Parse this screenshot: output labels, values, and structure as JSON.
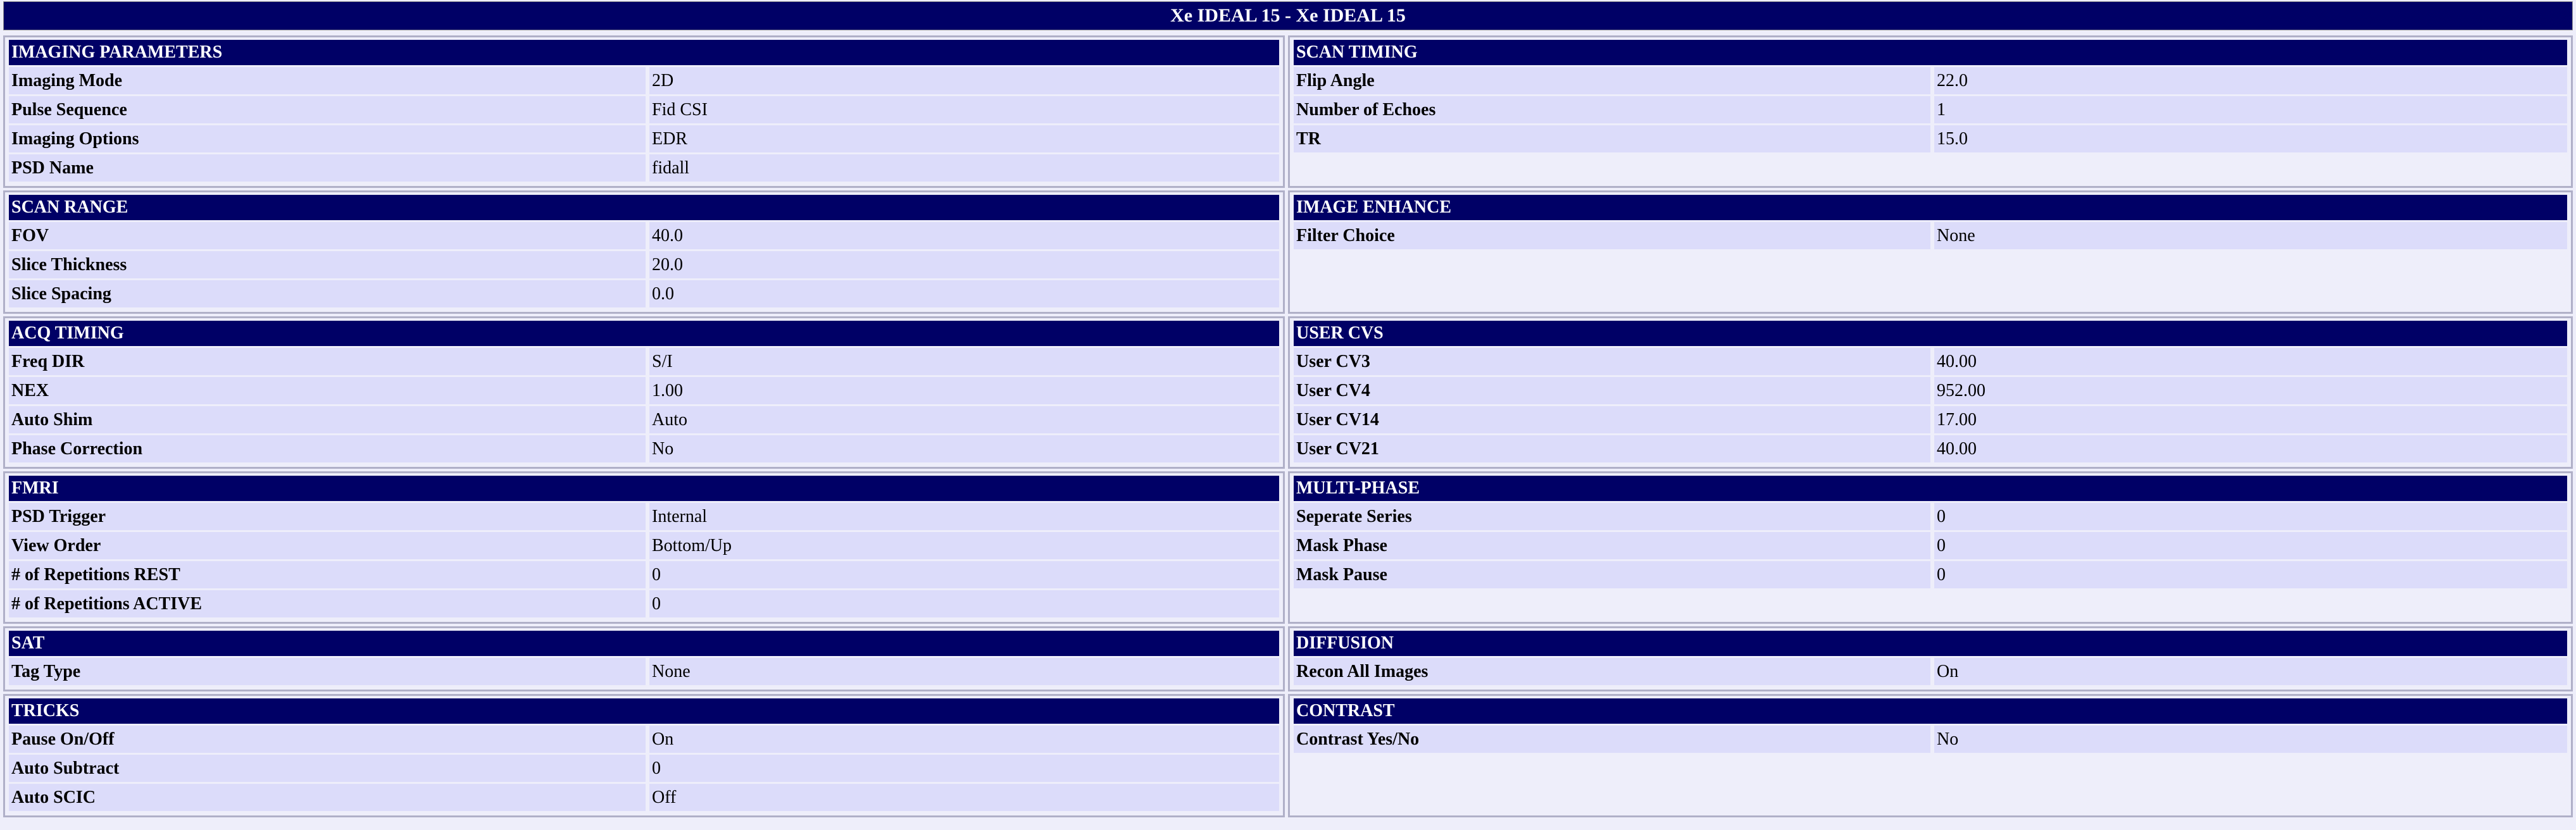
{
  "title": "Xe IDEAL 15 - Xe IDEAL 15",
  "rows": [
    {
      "rows_per_cell": 4,
      "left": {
        "header": "IMAGING PARAMETERS",
        "items": [
          {
            "label": "Imaging Mode",
            "value": "2D"
          },
          {
            "label": "Pulse Sequence",
            "value": "Fid CSI"
          },
          {
            "label": "Imaging Options",
            "value": "EDR"
          },
          {
            "label": "PSD Name",
            "value": "fidall"
          }
        ]
      },
      "right": {
        "header": "SCAN TIMING",
        "items": [
          {
            "label": "Flip Angle",
            "value": "22.0"
          },
          {
            "label": "Number of Echoes",
            "value": "1"
          },
          {
            "label": "TR",
            "value": "15.0"
          }
        ]
      }
    },
    {
      "rows_per_cell": 3,
      "left": {
        "header": "SCAN RANGE",
        "items": [
          {
            "label": "FOV",
            "value": "40.0"
          },
          {
            "label": "Slice Thickness",
            "value": "20.0"
          },
          {
            "label": "Slice Spacing",
            "value": "0.0"
          }
        ]
      },
      "right": {
        "header": "IMAGE ENHANCE",
        "items": [
          {
            "label": "Filter Choice",
            "value": "None"
          }
        ]
      }
    },
    {
      "rows_per_cell": 4,
      "left": {
        "header": "ACQ TIMING",
        "items": [
          {
            "label": "Freq DIR",
            "value": "S/I"
          },
          {
            "label": "NEX",
            "value": "1.00"
          },
          {
            "label": "Auto Shim",
            "value": "Auto"
          },
          {
            "label": "Phase Correction",
            "value": "No"
          }
        ]
      },
      "right": {
        "header": "USER CVS",
        "items": [
          {
            "label": "User CV3",
            "value": "40.00"
          },
          {
            "label": "User CV4",
            "value": "952.00"
          },
          {
            "label": "User CV14",
            "value": "17.00"
          },
          {
            "label": "User CV21",
            "value": "40.00"
          }
        ]
      }
    },
    {
      "rows_per_cell": 4,
      "left": {
        "header": "FMRI",
        "items": [
          {
            "label": "PSD Trigger",
            "value": "Internal"
          },
          {
            "label": "View Order",
            "value": "Bottom/Up"
          },
          {
            "label": "# of Repetitions REST",
            "value": "0"
          },
          {
            "label": "# of Repetitions ACTIVE",
            "value": "0"
          }
        ]
      },
      "right": {
        "header": "MULTI-PHASE",
        "items": [
          {
            "label": "Seperate Series",
            "value": "0"
          },
          {
            "label": "Mask Phase",
            "value": "0"
          },
          {
            "label": "Mask Pause",
            "value": "0"
          }
        ]
      }
    },
    {
      "rows_per_cell": 1,
      "left": {
        "header": "SAT",
        "items": [
          {
            "label": "Tag Type",
            "value": "None"
          }
        ]
      },
      "right": {
        "header": "DIFFUSION",
        "items": [
          {
            "label": "Recon All Images",
            "value": "On"
          }
        ]
      }
    },
    {
      "rows_per_cell": 3,
      "left": {
        "header": "TRICKS",
        "items": [
          {
            "label": "Pause On/Off",
            "value": "On"
          },
          {
            "label": "Auto Subtract",
            "value": "0"
          },
          {
            "label": "Auto SCIC",
            "value": "Off"
          }
        ]
      },
      "right": {
        "header": "CONTRAST",
        "items": [
          {
            "label": "Contrast Yes/No",
            "value": "No"
          }
        ]
      }
    }
  ]
}
